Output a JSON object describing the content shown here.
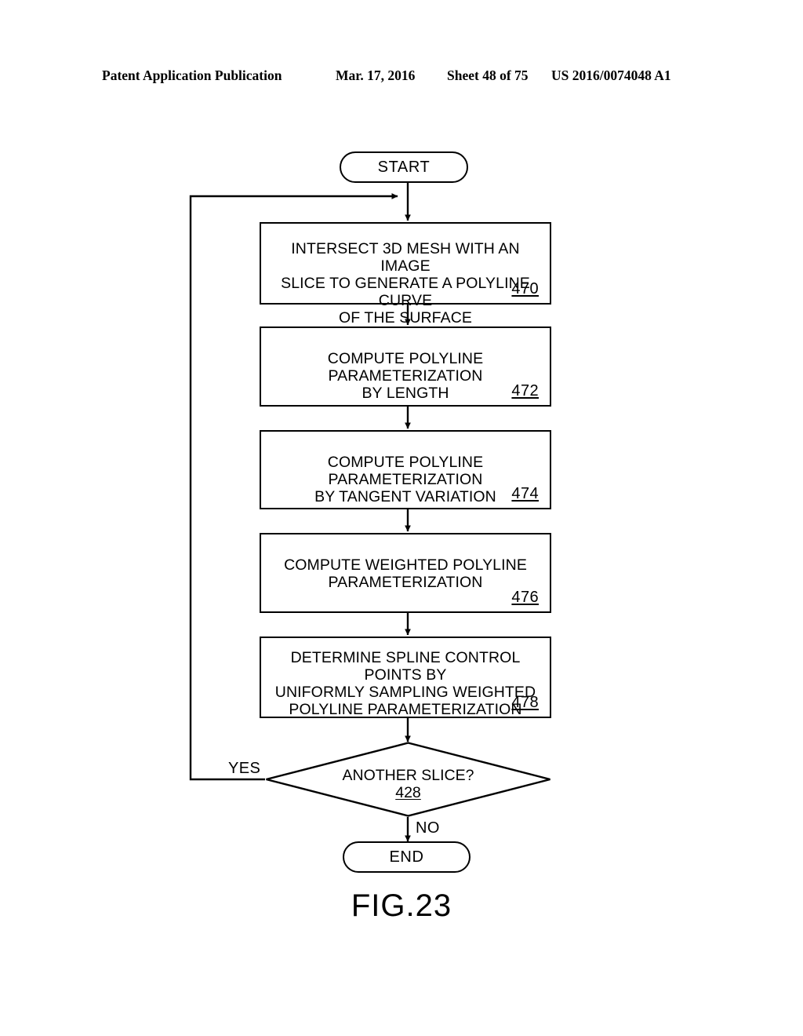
{
  "header": {
    "left": "Patent Application Publication",
    "date": "Mar. 17, 2016",
    "sheet": "Sheet 48 of 75",
    "publication_number": "US 2016/0074048 A1"
  },
  "figure": {
    "caption": "FIG.23"
  },
  "flowchart": {
    "start": {
      "label": "START"
    },
    "end": {
      "label": "END"
    },
    "steps": [
      {
        "id": "step-470",
        "text": "INTERSECT 3D MESH WITH AN IMAGE\nSLICE TO GENERATE A POLYLINE CURVE\nOF THE SURFACE",
        "ref": "470"
      },
      {
        "id": "step-472",
        "text": "COMPUTE POLYLINE PARAMETERIZATION\nBY LENGTH",
        "ref": "472"
      },
      {
        "id": "step-474",
        "text": "COMPUTE POLYLINE PARAMETERIZATION\nBY TANGENT VARIATION",
        "ref": "474"
      },
      {
        "id": "step-476",
        "text": "COMPUTE WEIGHTED POLYLINE\nPARAMETERIZATION",
        "ref": "476"
      },
      {
        "id": "step-478",
        "text": "DETERMINE SPLINE CONTROL POINTS BY\nUNIFORMLY SAMPLING WEIGHTED\nPOLYLINE PARAMETERIZATION",
        "ref": "478"
      }
    ],
    "decision": {
      "id": "decision-428",
      "text": "ANOTHER SLICE?",
      "ref": "428",
      "yes_label": "YES",
      "no_label": "NO"
    }
  },
  "colors": {
    "ink": "#000000",
    "paper": "#ffffff"
  }
}
